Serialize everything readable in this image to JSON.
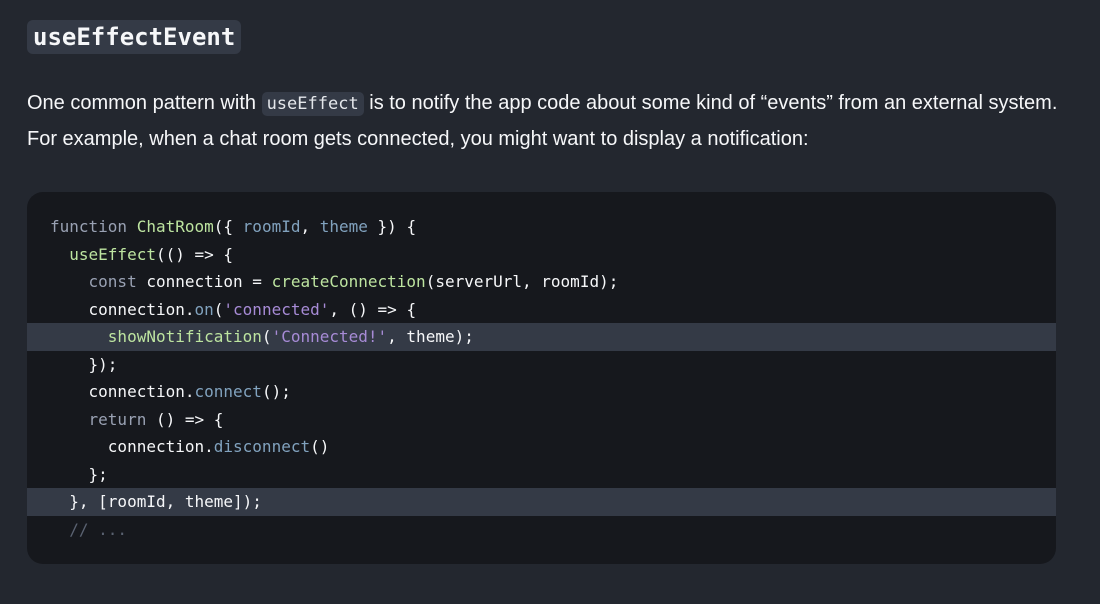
{
  "heading": "useEffectEvent",
  "paragraph": {
    "before": "One common pattern with ",
    "inline_code": "useEffect",
    "after": " is to notify the app code about some kind of “events” from an external system. For example, when a chat room gets connected, you might want to display a notification:"
  },
  "code": {
    "lines": [
      {
        "highlight": false,
        "tokens": [
          {
            "t": "kw",
            "v": "function "
          },
          {
            "t": "fn",
            "v": "ChatRoom"
          },
          {
            "t": "tx",
            "v": "({ "
          },
          {
            "t": "prop",
            "v": "roomId"
          },
          {
            "t": "tx",
            "v": ", "
          },
          {
            "t": "prop",
            "v": "theme"
          },
          {
            "t": "tx",
            "v": " }) {"
          }
        ]
      },
      {
        "highlight": false,
        "tokens": [
          {
            "t": "tx",
            "v": "  "
          },
          {
            "t": "fn",
            "v": "useEffect"
          },
          {
            "t": "tx",
            "v": "(() => {"
          }
        ]
      },
      {
        "highlight": false,
        "tokens": [
          {
            "t": "tx",
            "v": "    "
          },
          {
            "t": "kw",
            "v": "const"
          },
          {
            "t": "tx",
            "v": " connection = "
          },
          {
            "t": "fn",
            "v": "createConnection"
          },
          {
            "t": "tx",
            "v": "(serverUrl, roomId);"
          }
        ]
      },
      {
        "highlight": false,
        "tokens": [
          {
            "t": "tx",
            "v": "    connection."
          },
          {
            "t": "prop",
            "v": "on"
          },
          {
            "t": "tx",
            "v": "("
          },
          {
            "t": "str",
            "v": "'connected'"
          },
          {
            "t": "tx",
            "v": ", () => {"
          }
        ]
      },
      {
        "highlight": true,
        "tokens": [
          {
            "t": "tx",
            "v": "      "
          },
          {
            "t": "fn",
            "v": "showNotification"
          },
          {
            "t": "tx",
            "v": "("
          },
          {
            "t": "str",
            "v": "'Connected!'"
          },
          {
            "t": "tx",
            "v": ", theme);"
          }
        ]
      },
      {
        "highlight": false,
        "tokens": [
          {
            "t": "tx",
            "v": "    });"
          }
        ]
      },
      {
        "highlight": false,
        "tokens": [
          {
            "t": "tx",
            "v": "    connection."
          },
          {
            "t": "prop",
            "v": "connect"
          },
          {
            "t": "tx",
            "v": "();"
          }
        ]
      },
      {
        "highlight": false,
        "tokens": [
          {
            "t": "tx",
            "v": "    "
          },
          {
            "t": "kw",
            "v": "return"
          },
          {
            "t": "tx",
            "v": " () => {"
          }
        ]
      },
      {
        "highlight": false,
        "tokens": [
          {
            "t": "tx",
            "v": "      connection."
          },
          {
            "t": "prop",
            "v": "disconnect"
          },
          {
            "t": "tx",
            "v": "()"
          }
        ]
      },
      {
        "highlight": false,
        "tokens": [
          {
            "t": "tx",
            "v": "    };"
          }
        ]
      },
      {
        "highlight": true,
        "tokens": [
          {
            "t": "tx",
            "v": "  }, [roomId, theme]);"
          }
        ]
      },
      {
        "highlight": false,
        "tokens": [
          {
            "t": "tx",
            "v": "  "
          },
          {
            "t": "cm",
            "v": "// ..."
          }
        ]
      }
    ]
  }
}
